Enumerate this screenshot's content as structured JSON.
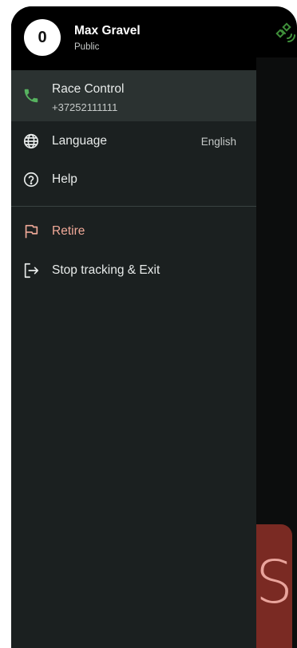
{
  "user": {
    "avatar_text": "0",
    "name": "Max Gravel",
    "status": "Public"
  },
  "menu": {
    "race_control": {
      "label": "Race Control",
      "phone": "+37252111111",
      "icon": "phone-icon"
    },
    "language": {
      "label": "Language",
      "value": "English",
      "icon": "globe-icon"
    },
    "help": {
      "label": "Help",
      "icon": "help-circle-icon"
    },
    "retire": {
      "label": "Retire",
      "icon": "flag-icon"
    },
    "stop": {
      "label": "Stop tracking & Exit",
      "icon": "exit-icon"
    }
  },
  "background": {
    "card_letter": "S"
  },
  "colors": {
    "drawer_bg": "#1b2020",
    "selected_bg": "#2b3231",
    "phone_green": "#56b25f",
    "retire_accent": "#f0a998",
    "satellite_green": "#3f8f3a"
  }
}
